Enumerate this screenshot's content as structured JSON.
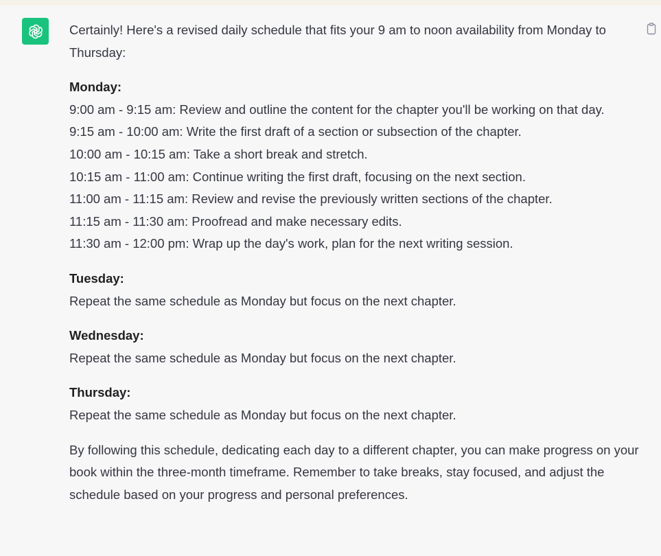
{
  "message": {
    "intro": "Certainly! Here's a revised daily schedule that fits your 9 am to noon availability from Monday to Thursday:",
    "days": [
      {
        "heading": "Monday:",
        "lines": [
          "9:00 am - 9:15 am: Review and outline the content for the chapter you'll be working on that day.",
          "9:15 am - 10:00 am: Write the first draft of a section or subsection of the chapter.",
          "10:00 am - 10:15 am: Take a short break and stretch.",
          "10:15 am - 11:00 am: Continue writing the first draft, focusing on the next section.",
          "11:00 am - 11:15 am: Review and revise the previously written sections of the chapter.",
          "11:15 am - 11:30 am: Proofread and make necessary edits.",
          "11:30 am - 12:00 pm: Wrap up the day's work, plan for the next writing session."
        ]
      },
      {
        "heading": "Tuesday:",
        "lines": [
          "Repeat the same schedule as Monday but focus on the next chapter."
        ]
      },
      {
        "heading": "Wednesday:",
        "lines": [
          "Repeat the same schedule as Monday but focus on the next chapter."
        ]
      },
      {
        "heading": "Thursday:",
        "lines": [
          "Repeat the same schedule as Monday but focus on the next chapter."
        ]
      }
    ],
    "closing": "By following this schedule, dedicating each day to a different chapter, you can make progress on your book within the three-month timeframe. Remember to take breaks, stay focused, and adjust the schedule based on your progress and personal preferences."
  },
  "icons": {
    "avatar": "openai-logo-icon",
    "copy": "clipboard-icon"
  },
  "colors": {
    "avatar_bg": "#19c37d",
    "panel_bg": "#f7f7f8",
    "page_bg": "#f6f1e9",
    "text": "#353740"
  }
}
